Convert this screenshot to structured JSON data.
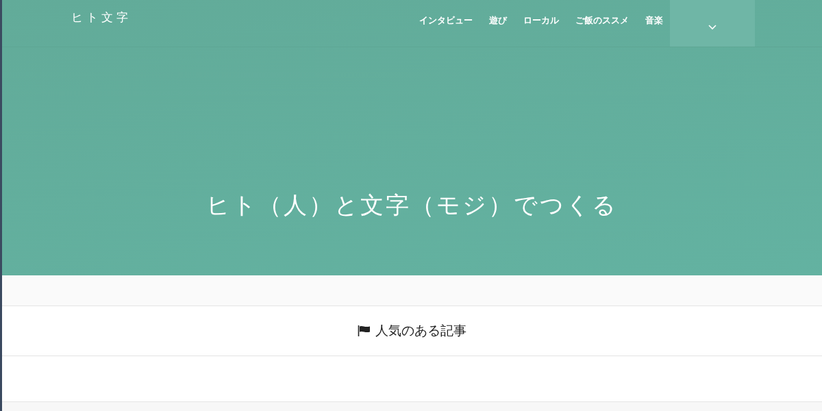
{
  "site_title": "ヒト文字",
  "nav": [
    {
      "label": "インタビュー"
    },
    {
      "label": "遊び"
    },
    {
      "label": "ローカル"
    },
    {
      "label": "ご飯のススメ"
    },
    {
      "label": "音楽"
    }
  ],
  "hero": {
    "tagline": "ヒト（人）と文字（モジ）でつくる"
  },
  "popular": {
    "heading": "人気のある記事"
  }
}
